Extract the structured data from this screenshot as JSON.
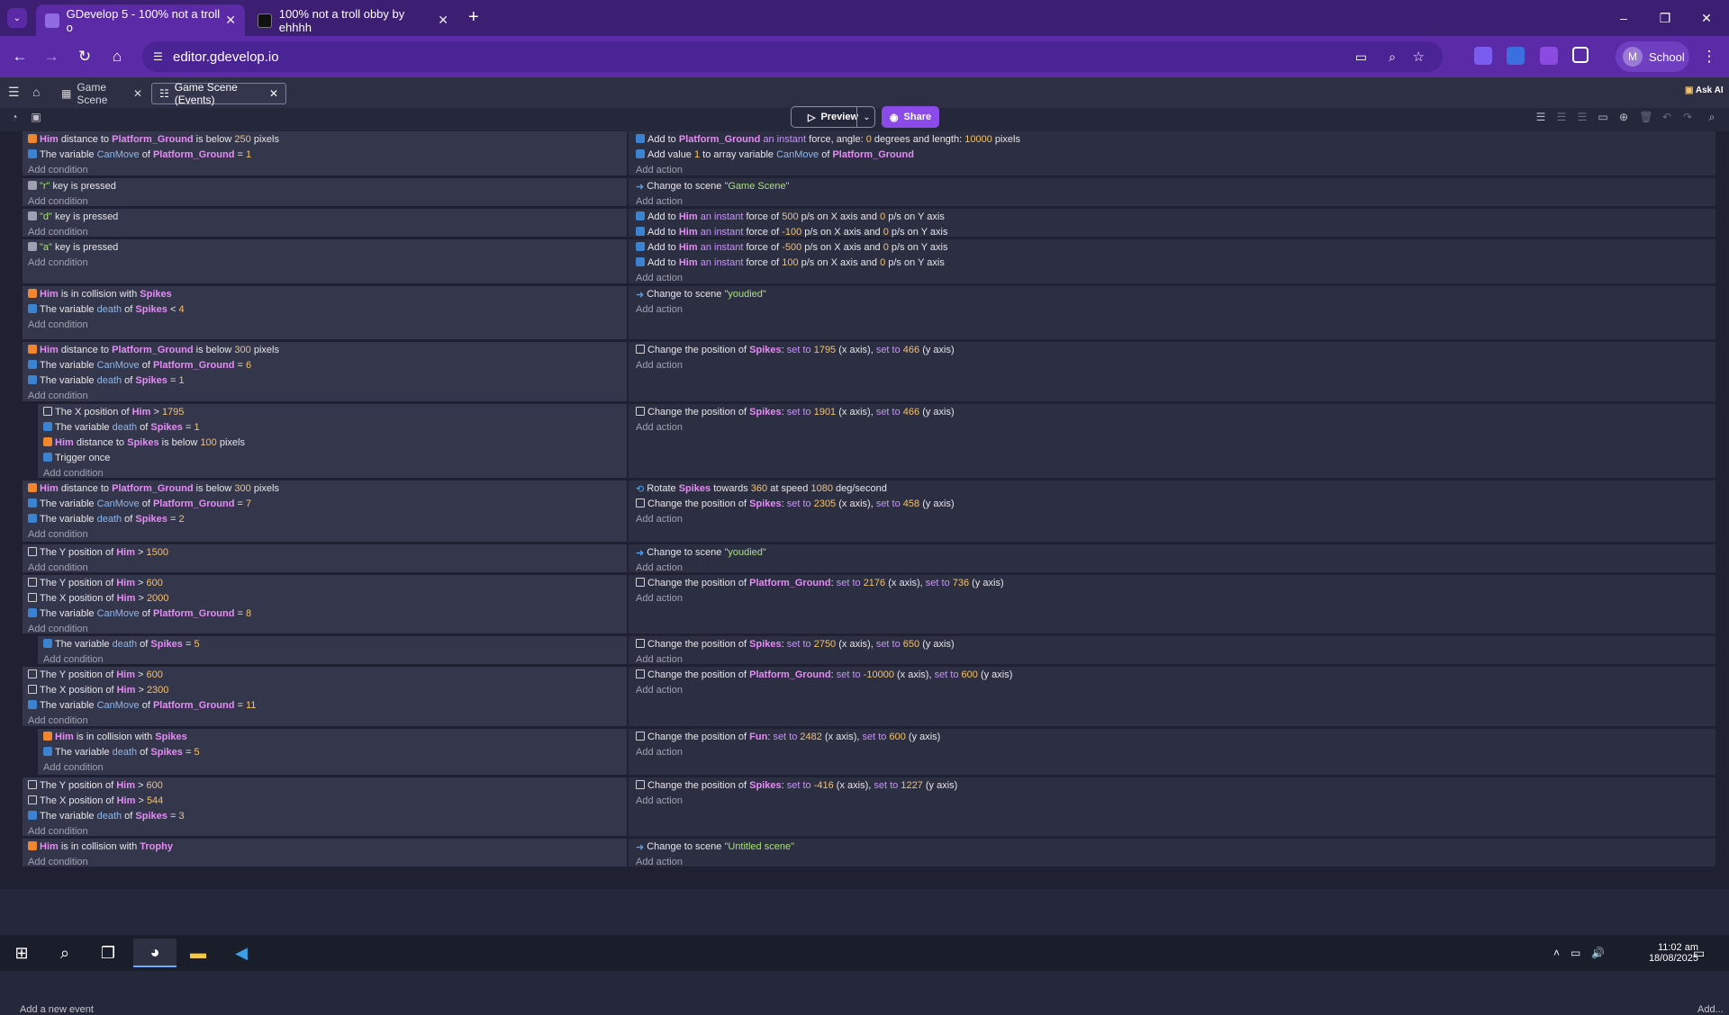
{
  "browser": {
    "tabs": [
      {
        "title": "GDevelop 5 - 100% not a troll o",
        "active": true
      },
      {
        "title": "100% not a troll obby by ehhhh",
        "active": false
      }
    ],
    "new_tab": "+",
    "url": "editor.gdevelop.io",
    "profile_initial": "M",
    "profile_label": "School",
    "window_controls": [
      "–",
      "❐",
      "✕"
    ]
  },
  "app": {
    "tabs": [
      {
        "label": "Game Scene",
        "active": false
      },
      {
        "label": "Game Scene (Events)",
        "active": true
      }
    ],
    "ask_ai": "Ask AI",
    "preview_label": "Preview",
    "share_label": "Share",
    "add_new_event": "Add a new event",
    "add_right": "Add..."
  },
  "events": [
    {
      "conditions": [
        "Him distance to Platform_Ground is below 250 pixels",
        "The variable CanMove of Platform_Ground = 1"
      ],
      "actions": [
        "Add to Platform_Ground an instant force, angle: 0 degrees and length: 10000 pixels",
        "Add value 1 to array variable CanMove of Platform_Ground"
      ]
    },
    {
      "conditions": [
        "\"r\" key is pressed"
      ],
      "actions": [
        "Change to scene \"Game Scene\""
      ]
    },
    {
      "conditions": [
        "\"d\" key is pressed"
      ],
      "actions": [
        "Add to Him an instant force of 500 p/s on X axis and 0 p/s on Y axis",
        "Add to Him an instant force of -100 p/s on X axis and 0 p/s on Y axis"
      ]
    },
    {
      "conditions": [
        "\"a\" key is pressed"
      ],
      "actions": [
        "Add to Him an instant force of -500 p/s on X axis and 0 p/s on Y axis",
        "Add to Him an instant force of 100 p/s on X axis and 0 p/s on Y axis"
      ]
    },
    {
      "conditions": [
        "Him is in collision with Spikes",
        "The variable death of Spikes < 4"
      ],
      "actions": [
        "Change to scene \"youdied\""
      ]
    },
    {
      "conditions": [
        "Him distance to Platform_Ground is below 300 pixels",
        "The variable CanMove of Platform_Ground = 6",
        "The variable death of Spikes = 1"
      ],
      "actions": [
        "Change the position of Spikes: set to 1795 (x axis), set to 466 (y axis)"
      ]
    },
    {
      "conditions": [
        "The X position of Him > 1795",
        "The variable death of Spikes = 1",
        "Him distance to Spikes is below 100 pixels",
        "Trigger once"
      ],
      "actions": [
        "Change the position of Spikes: set to 1901 (x axis), set to 466 (y axis)"
      ]
    },
    {
      "conditions": [
        "Him distance to Platform_Ground is below 300 pixels",
        "The variable CanMove of Platform_Ground = 7",
        "The variable death of Spikes = 2"
      ],
      "actions": [
        "Rotate Spikes towards 360 at speed 1080 deg/second",
        "Change the position of Spikes: set to 2305 (x axis), set to 458 (y axis)"
      ]
    },
    {
      "conditions": [
        "The Y position of Him > 1500"
      ],
      "actions": [
        "Change to scene \"youdied\""
      ]
    },
    {
      "conditions": [
        "The Y position of Him > 600",
        "The X position of Him > 2000",
        "The variable CanMove of Platform_Ground = 8"
      ],
      "actions": [
        "Change the position of Platform_Ground: set to 2176 (x axis), set to 736 (y axis)"
      ]
    },
    {
      "conditions": [
        "The variable death of Spikes = 5"
      ],
      "actions": [
        "Change the position of Spikes: set to 2750 (x axis), set to 650 (y axis)"
      ]
    },
    {
      "conditions": [
        "The Y position of Him > 600",
        "The X position of Him > 2300",
        "The variable CanMove of Platform_Ground = 11"
      ],
      "actions": [
        "Change the position of Platform_Ground: set to -10000 (x axis), set to 600 (y axis)"
      ]
    },
    {
      "conditions": [
        "Him is in collision with Spikes",
        "The variable death of Spikes = 5"
      ],
      "actions": [
        "Change the position of Fun: set to 2482 (x axis), set to 600 (y axis)"
      ]
    },
    {
      "conditions": [
        "The Y position of Him > 600",
        "The X position of Him > 544",
        "The variable death of Spikes = 3"
      ],
      "actions": [
        "Change the position of Spikes: set to -416 (x axis), set to 1227 (y axis)"
      ]
    },
    {
      "conditions": [
        "Him is in collision with Trophy"
      ],
      "actions": [
        "Change to scene \"Untitled scene\""
      ]
    }
  ],
  "labels": {
    "add_condition": "Add condition",
    "add_action": "Add action"
  },
  "taskbar": {
    "time": "11:02 am",
    "date": "18/08/2025"
  },
  "colors": {
    "browser_frame": "#3c1f73",
    "address_bar": "#5b2aa6",
    "share_button": "#8a4be8",
    "object_name": "#e58cf5",
    "number": "#f5c26b"
  }
}
